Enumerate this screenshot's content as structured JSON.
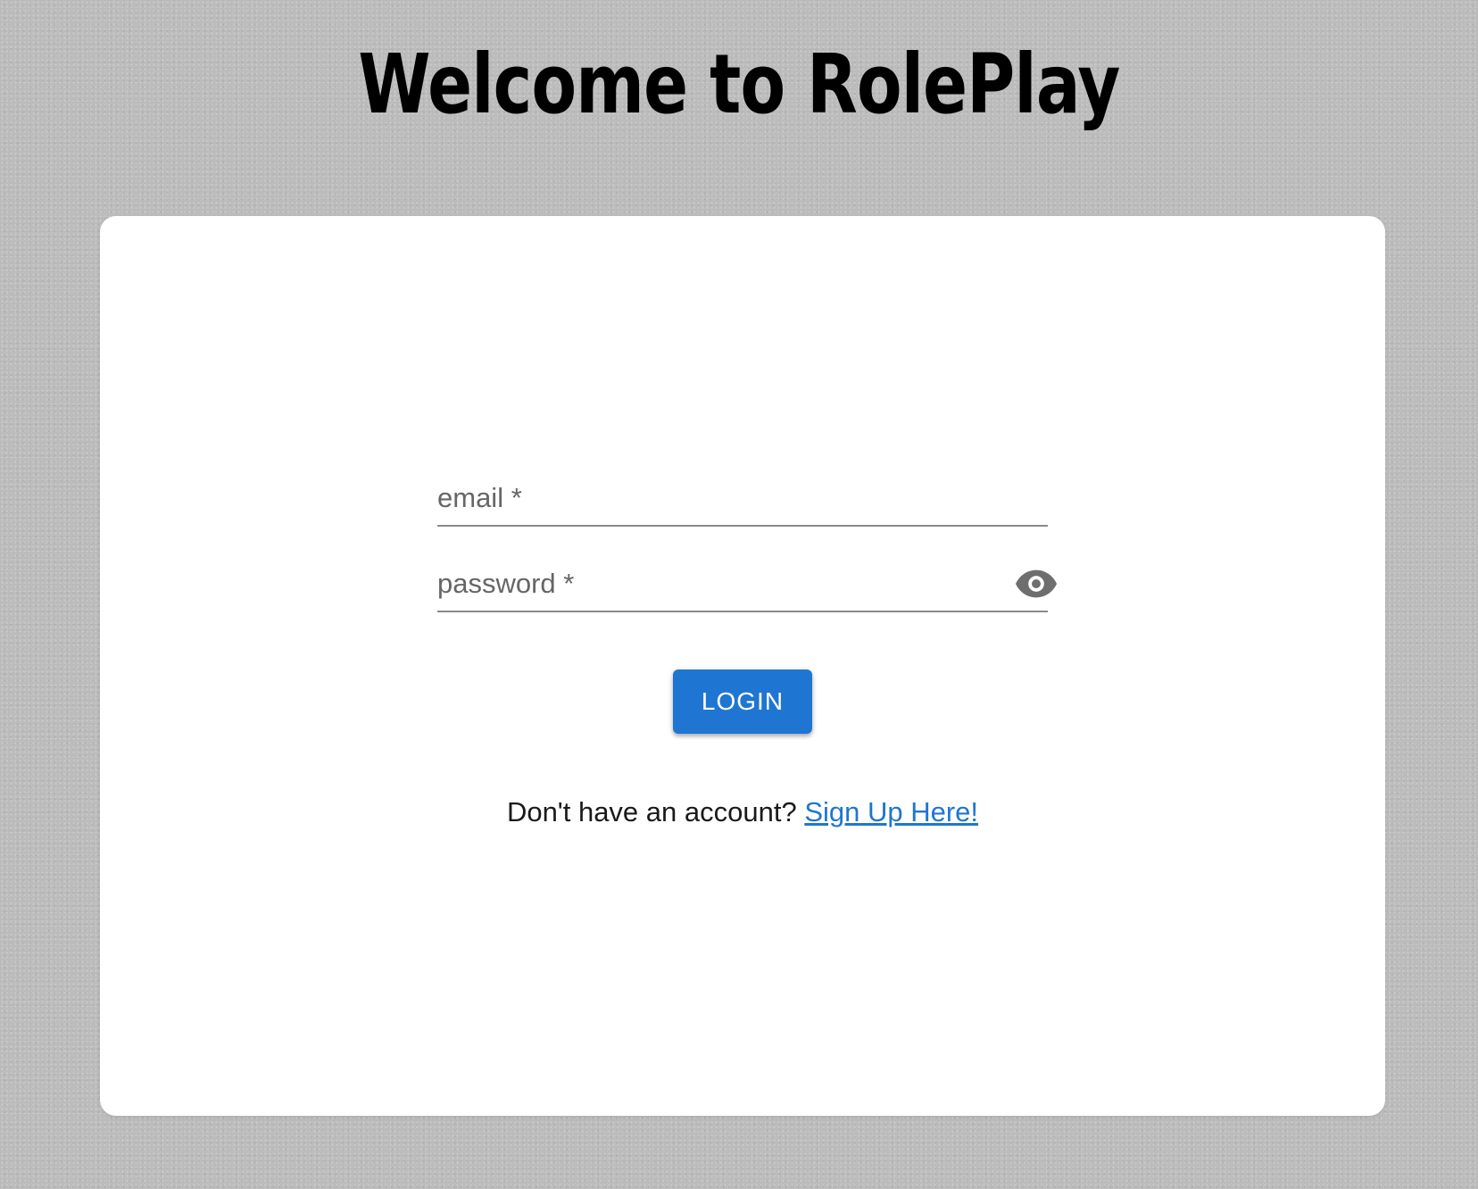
{
  "header": {
    "title": "Welcome to RolePlay"
  },
  "form": {
    "email_label": "email *",
    "password_label": "password *",
    "login_label": "LOGIN",
    "signup_prompt": "Don't have an account?",
    "signup_link": "Sign Up Here!"
  },
  "icons": {
    "password_toggle": "eye-icon"
  },
  "colors": {
    "primary": "#1f76d2",
    "card": "#ffffff",
    "background": "#b9b9b9"
  }
}
